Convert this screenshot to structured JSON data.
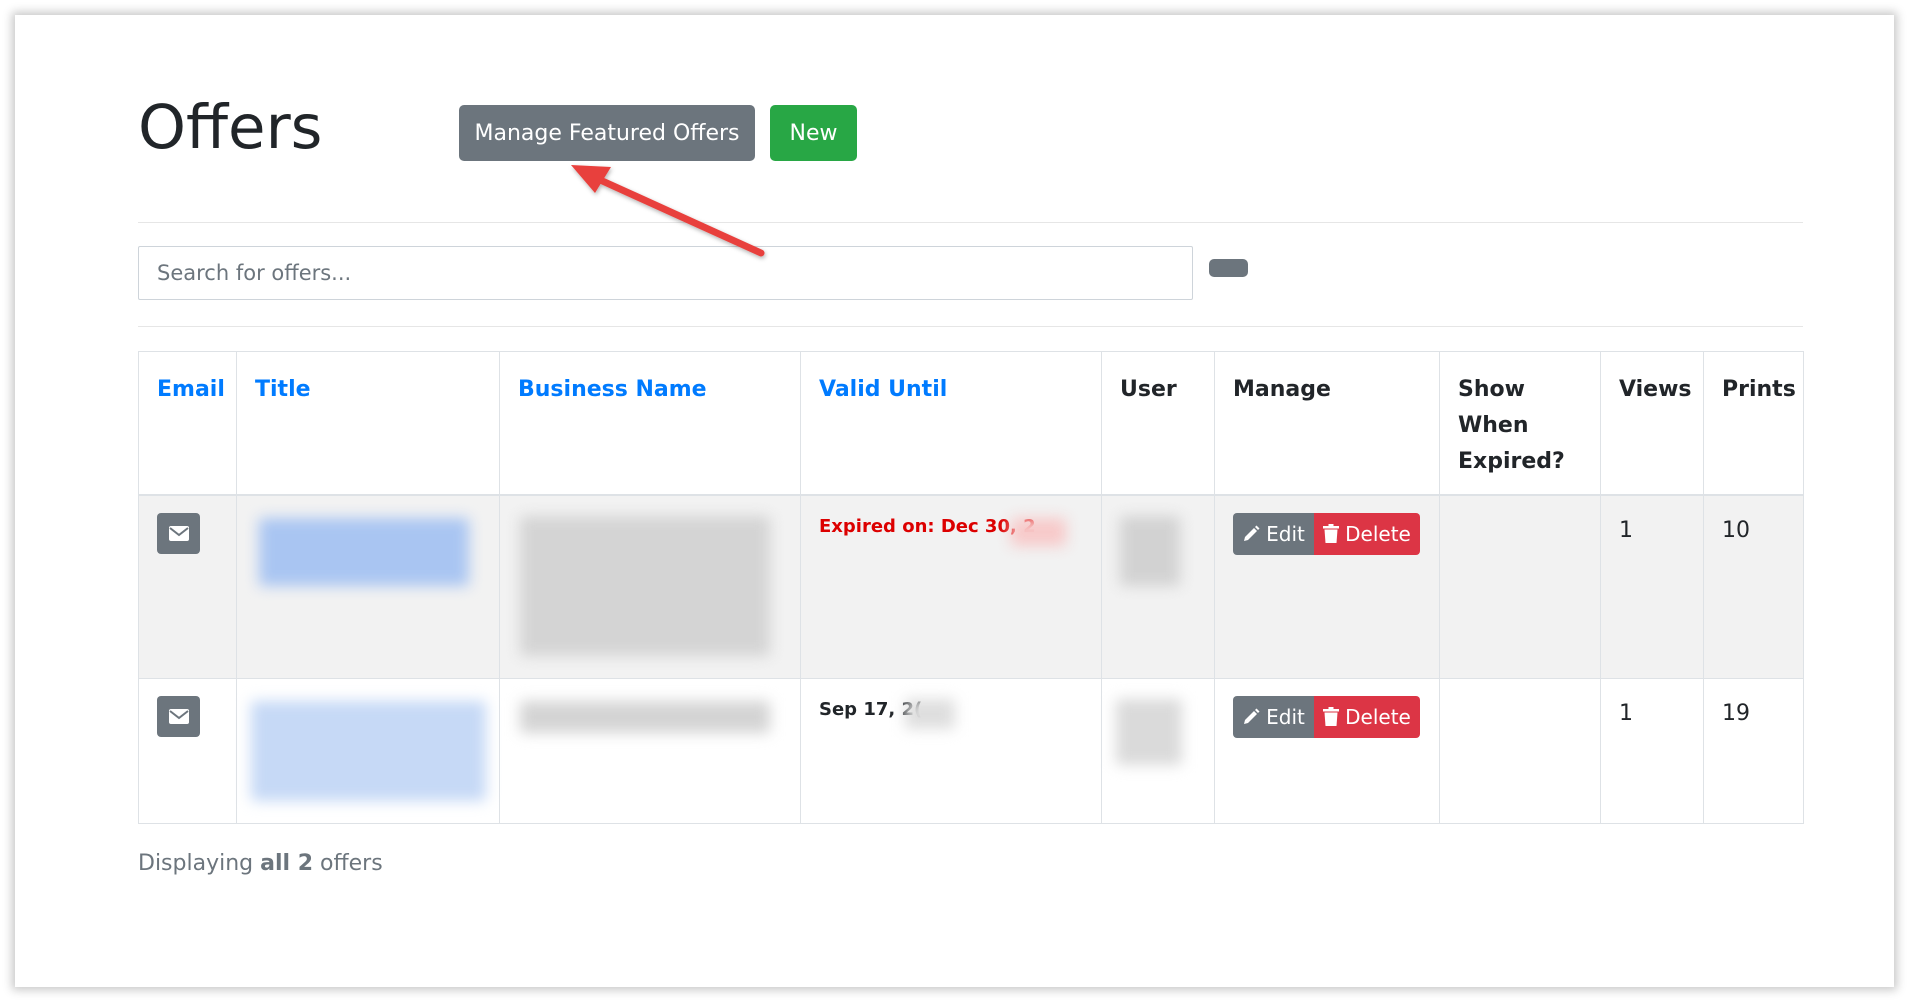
{
  "header": {
    "title": "Offers",
    "manage_featured_label": "Manage Featured Offers",
    "new_label": "New"
  },
  "search": {
    "placeholder": "Search for offers..."
  },
  "table": {
    "columns": {
      "email": "Email",
      "title": "Title",
      "business_name": "Business Name",
      "valid_until": "Valid Until",
      "user": "User",
      "manage": "Manage",
      "show_when_expired_1": "Show",
      "show_when_expired_2": "When",
      "show_when_expired_3": "Expired?",
      "views": "Views",
      "prints": "Prints"
    },
    "rows": [
      {
        "valid_until": "Expired on: Dec 30, 2",
        "edit_label": "Edit",
        "delete_label": "Delete",
        "views": "1",
        "prints": "10"
      },
      {
        "valid_until": "Sep 17, 2(",
        "edit_label": "Edit",
        "delete_label": "Delete",
        "views": "1",
        "prints": "19"
      }
    ]
  },
  "footer": {
    "prefix": "Displaying",
    "all": "all 2",
    "suffix": "offers"
  },
  "colors": {
    "primary_link": "#007bff",
    "secondary": "#6c757d",
    "success": "#28a745",
    "danger": "#dc3545",
    "expired_text": "#dc0000",
    "annotation_arrow": "#e8413c"
  },
  "icons": [
    "envelope-icon",
    "pencil-icon",
    "trash-icon",
    "annotation-arrow"
  ]
}
